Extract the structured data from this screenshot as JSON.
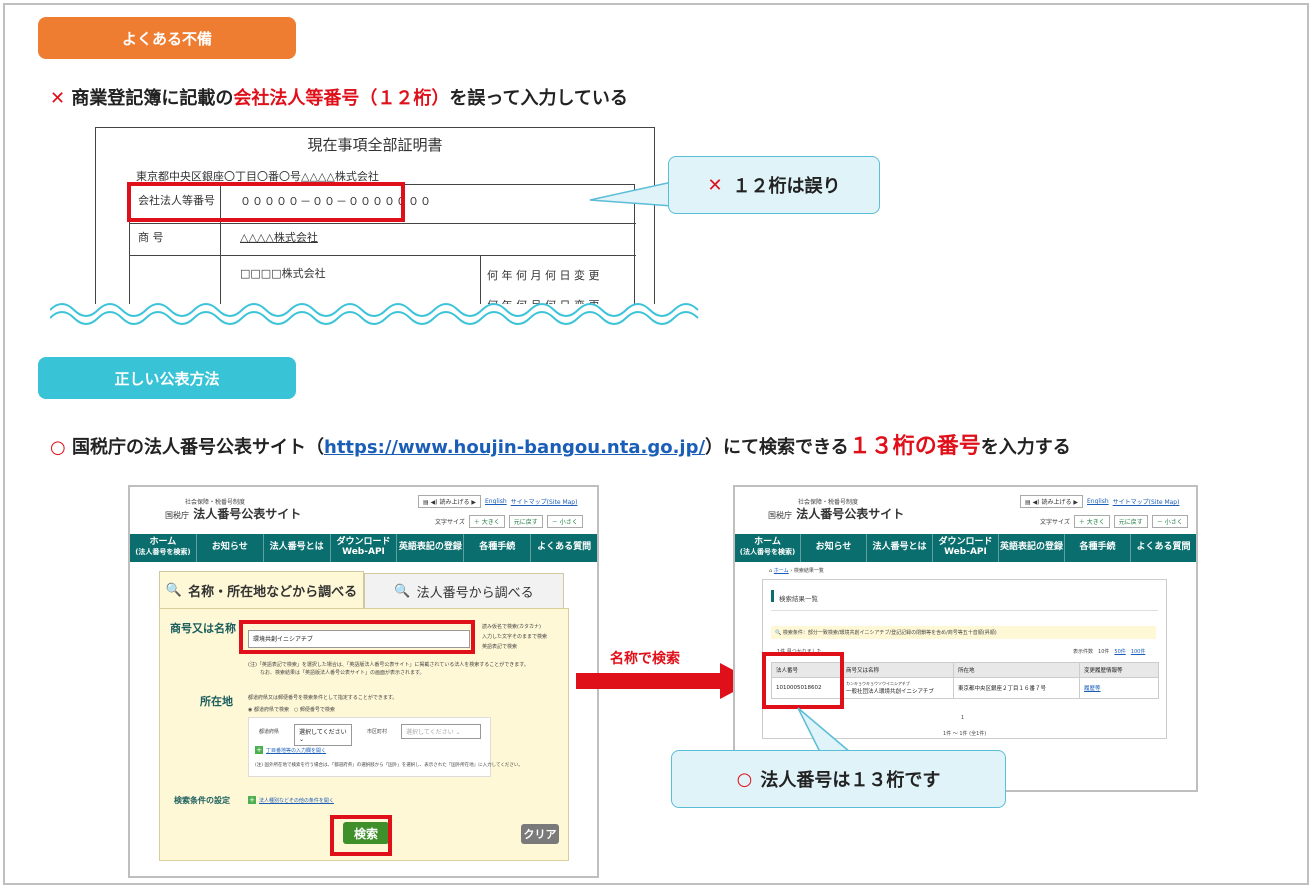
{
  "section1": {
    "pill_label": "よくある不備",
    "pill_color": "#ee7d31",
    "headline_mark": "✕",
    "headline_before": "商業登記簿に記載の",
    "headline_highlight": "会社法人等番号（１２桁）",
    "headline_after": "を誤って入力している"
  },
  "certificate": {
    "title": "現在事項全部証明書",
    "address": "東京都中央区銀座〇丁目〇番〇号△△△△株式会社",
    "row1_label": "会社法人等番号",
    "row1_value": "０００００－００－０００００００",
    "row2_label": "商 号",
    "row2_value": "△△△△株式会社",
    "row3_value": "□□□□株式会社",
    "change_text_1": "何 年 何 月 何 日 変 更",
    "change_text_2": "何 年 何 月 何 日 変 更"
  },
  "bubble_wrong": {
    "mark": "✕",
    "text": "１２桁は誤り"
  },
  "section2": {
    "pill_label": "正しい公表方法",
    "pill_color": "#39c3d6",
    "headline_mark": "○",
    "headline_before": "国税庁の法人番号公表サイト（",
    "headline_link": "https://www.houjin-bangou.nta.go.jp/",
    "headline_middle": "）にて検索できる",
    "headline_highlight": "１３桁の番号",
    "headline_after": "を入力する"
  },
  "site": {
    "subtitle": "社会保障・税番号制度",
    "agency": "国税庁",
    "name": "法人番号公表サイト",
    "read_aloud": "読み上げる",
    "english": "English",
    "sitemap": "サイトマップ(Site Map)",
    "font_size_label": "文字サイズ",
    "font_larger": "大きく",
    "font_reset": "元に戻す",
    "font_smaller": "小さく",
    "nav": [
      {
        "l1": "ホーム",
        "l2": "(法人番号を検索)"
      },
      {
        "l1": "お知らせ",
        "l2": ""
      },
      {
        "l1": "法人番号とは",
        "l2": ""
      },
      {
        "l1": "ダウンロード",
        "l2": "Web-API"
      },
      {
        "l1": "英語表記の登録",
        "l2": ""
      },
      {
        "l1": "各種手続",
        "l2": ""
      },
      {
        "l1": "よくある質問",
        "l2": ""
      }
    ]
  },
  "search_form": {
    "tab_active": "名称・所在地などから調べる",
    "tab_inactive": "法人番号から調べる",
    "name_label": "商号又は名称",
    "name_value": "環境共創イニシアチブ",
    "name_note_1": "読み仮名で検索(カタカナ)",
    "name_note_2": "入力した文字そのままで検索",
    "name_note_3": "英語表記で検索",
    "name_caution_1": "(注)「英語表記で検索」を選択した場合は、「英語版法人番号公表サイト」に掲載されている法人を検索することができます。",
    "name_caution_2": "なお、検索結果は「英語版法人番号公表サイト」の画面が表示されます。",
    "loc_label": "所在地",
    "loc_desc": "都道府県又は郵便番号を検索条件として指定することができます。",
    "loc_radio_1": "都道府県で検索",
    "loc_radio_2": "郵便番号で検索",
    "pref_label": "都道府県",
    "pref_value": "選択してください",
    "city_label": "市区町村",
    "city_value": "選択してください",
    "chome_link": "丁目番地等の入力欄を開く",
    "abroad_note": "(注) 国外所在地で検索を行う場合は、「都道府県」の選択肢から「国外」を選択し、表示された「国外所在地」に入力してください。",
    "cond_label": "検索条件の設定",
    "cond_link": "法人種別などその他の条件を開く",
    "search_button": "検索",
    "clear_button": "クリア"
  },
  "arrow_label": "名称で検索",
  "results": {
    "breadcrumb_home": "ホーム",
    "breadcrumb_current": "検索結果一覧",
    "heading": "検索結果一覧",
    "condition": "検索条件：部分一致検索/環境共創イニシアチブ/登記記録の閉鎖等を含め/商号等五十音順(昇順)",
    "found": "1件 見つかりました。",
    "per_page_label": "表示件数",
    "per_page_opts": [
      "10件",
      "50件",
      "100件"
    ],
    "headers": [
      "法人番号",
      "商号又は名称",
      "所在地",
      "変更履歴情報等"
    ],
    "row": {
      "number": "1010005018602",
      "kana": "カンキョウキョウソウイニシアチブ",
      "name": "一般社団法人環境共創イニシアチブ",
      "address": "東京都中央区銀座２丁目１６番７号",
      "history": "履歴等"
    },
    "page_num": "1",
    "page_range": "1件 ～ 1件 (全1件)"
  },
  "bubble_right": {
    "mark": "○",
    "text": "法人番号は１３桁です"
  }
}
